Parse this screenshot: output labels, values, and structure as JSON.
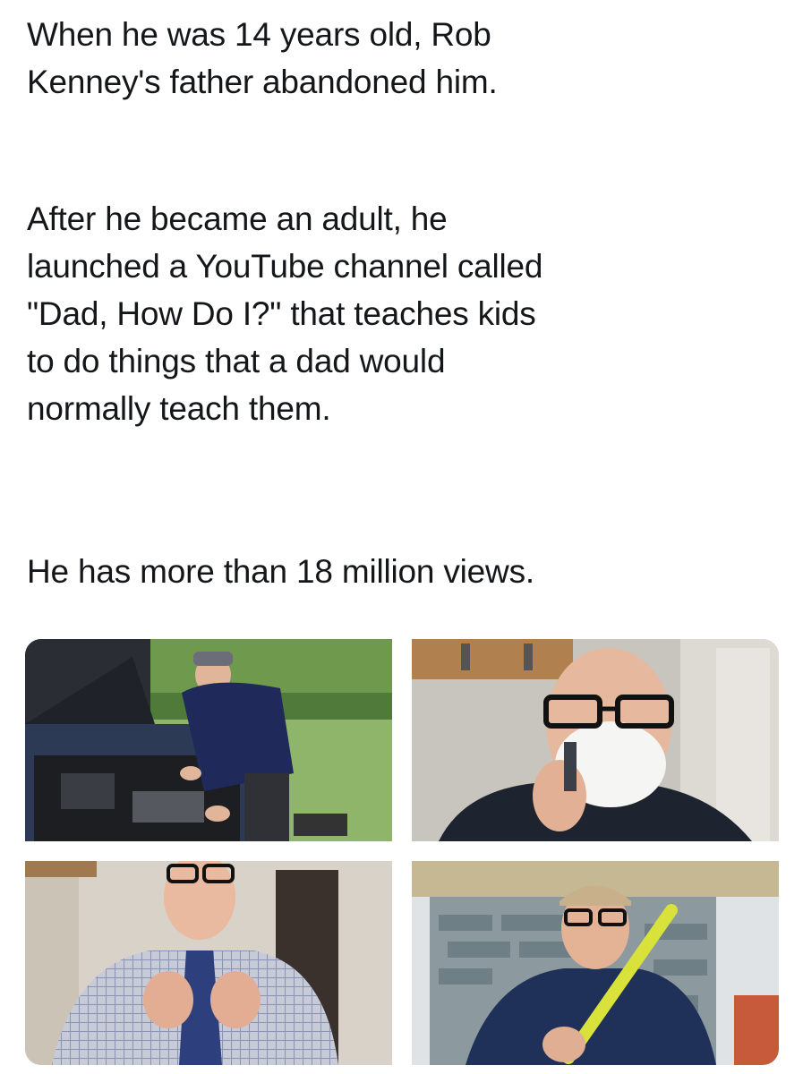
{
  "post": {
    "paragraphs": [
      "When he was 14 years old, Rob\nKenney's father abandoned him.",
      "After he became an adult, he\nlaunched a YouTube channel called\n\"Dad, How Do I?\" that teaches kids\nto do things that a dad would\nnormally teach them.",
      "He has more than 18 million views."
    ]
  },
  "photos": [
    {
      "name": "car-engine-photo",
      "subject": "man in cap leaning over open car hood"
    },
    {
      "name": "shaving-photo",
      "subject": "man with glasses shaving, face covered in shaving cream"
    },
    {
      "name": "tie-photo",
      "subject": "man in checkered shirt tying a necktie"
    },
    {
      "name": "tape-measure-photo",
      "subject": "man in cap holding a yellow level tool"
    }
  ],
  "colors": {
    "text": "#14171a",
    "background": "#ffffff"
  }
}
